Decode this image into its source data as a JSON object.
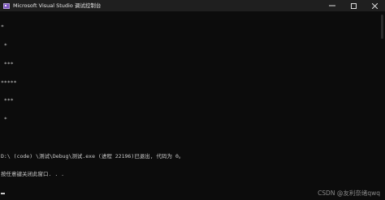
{
  "window": {
    "title": "Microsoft Visual Studio 调试控制台",
    "icon": "vs-debug-console-icon",
    "controls": {
      "minimize_icon": "minimize-icon",
      "maximize_icon": "maximize-icon",
      "close_icon": "close-icon"
    }
  },
  "console": {
    "lines": [
      "*",
      " *",
      " ***",
      "*****",
      " ***",
      " *",
      "",
      "D:\\ (code) \\测试\\Debug\\测试.exe (进程 22196)已退出, 代码为 0。",
      "按任意键关闭此窗口. . ."
    ],
    "text_color": "#cccccc",
    "background_color": "#0c0c0c"
  },
  "watermark": {
    "text": "CSDN @友利奈绪qwq"
  }
}
